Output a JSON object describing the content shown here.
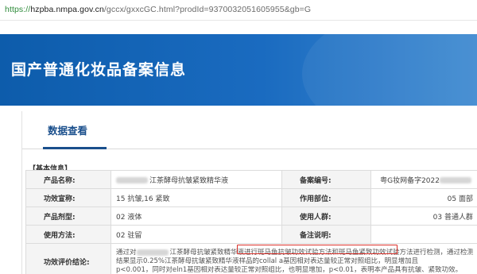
{
  "browser": {
    "url_scheme": "https://",
    "url_host": "hzpba.nmpa.gov.cn",
    "url_path": "/gccx/gxxcGC.html?prodId=9370032051605955&gb=G"
  },
  "banner": {
    "title": "国产普通化妆品备案信息"
  },
  "tabs": {
    "active": "数据查看"
  },
  "section": {
    "label": "【基本信息】"
  },
  "info": {
    "rows": [
      {
        "l1": "产品名称:",
        "v1": "江茶酵母抗皱紧致精华液",
        "l2": "备案编号:",
        "v2": "粤G妆网备字2022"
      },
      {
        "l1": "功效宣称:",
        "v1": "15 抗皱,16 紧致",
        "l2": "作用部位:",
        "v2": "05 面部"
      },
      {
        "l1": "产品剂型:",
        "v1": "02 液体",
        "l2": "使用人群:",
        "v2": "03 普通人群"
      },
      {
        "l1": "使用方法:",
        "v1": "02 驻留",
        "l2": "备注说明:",
        "v2": ""
      }
    ],
    "eval_label": "功效评价结论:",
    "eval_line1_a": "通过对",
    "eval_line1_b": "江茶酵母抗皱紧致精华液进行",
    "eval_line1_hl": "斑马鱼抗皱功效试验方法和斑马鱼紧致功效试验方法",
    "eval_line1_c": "进行检测，通过检测",
    "eval_line2": "结果显示0.25%江茶酵母抗皱紧致精华液样品的collal a基因相对表达量较正常对照组比，明显增加且",
    "eval_line3": "p<0.001，同时对eln1基因相对表达量较正常对照组比，也明显增加，p<0.01，表明本产品具有抗皱、紧致功效。"
  }
}
